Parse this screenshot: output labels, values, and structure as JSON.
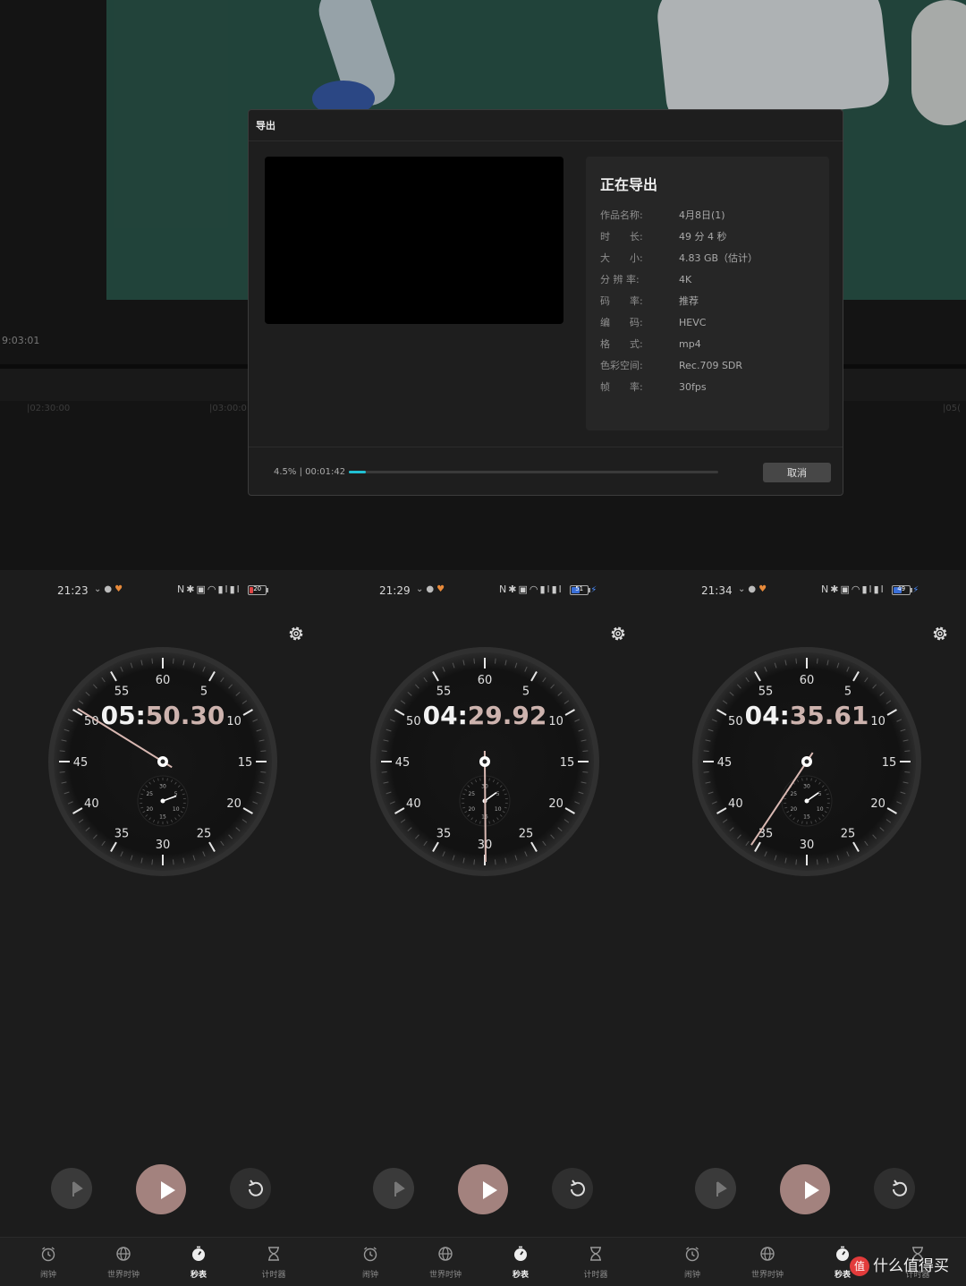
{
  "editor": {
    "timecode": "9:03:01",
    "ruler_labels": [
      "|02:30:00",
      "|03:00:0",
      "|05("
    ]
  },
  "export_dialog": {
    "title": "导出",
    "heading": "正在导出",
    "info": [
      {
        "key": "作品名称:",
        "value": "4月8日(1)"
      },
      {
        "key": "时　　长:",
        "value": "49 分 4 秒"
      },
      {
        "key": "大　　小:",
        "value": "4.83 GB（估计）"
      },
      {
        "key": "分 辨 率:",
        "value": "4K"
      },
      {
        "key": "码　　率:",
        "value": "推荐"
      },
      {
        "key": "编　　码:",
        "value": "HEVC"
      },
      {
        "key": "格　　式:",
        "value": "mp4"
      },
      {
        "key": "色彩空间:",
        "value": "Rec.709 SDR"
      },
      {
        "key": "帧　　率:",
        "value": "30fps"
      }
    ],
    "progress_percent": "4.5%",
    "progress_fraction": 0.045,
    "elapsed": "00:01:42",
    "cancel_label": "取消",
    "accent_color": "#21c0d3"
  },
  "phones": [
    {
      "status_time": "21:23",
      "battery": "20",
      "battery_color": "#e04545",
      "charging": false,
      "time_minutes": "05",
      "time_rest": "50.30",
      "seconds": 50.3,
      "small_hand_minutes": 5.83
    },
    {
      "status_time": "21:29",
      "battery": "51",
      "battery_color": "#3a6fd8",
      "charging": true,
      "time_minutes": "04",
      "time_rest": "29.92",
      "seconds": 29.92,
      "small_hand_minutes": 4.5
    },
    {
      "status_time": "21:34",
      "battery": "49",
      "battery_color": "#3a6fd8",
      "charging": true,
      "time_minutes": "04",
      "time_rest": "35.61",
      "seconds": 35.61,
      "small_hand_minutes": 4.59
    }
  ],
  "dial": {
    "major_labels": [
      "60",
      "5",
      "10",
      "15",
      "20",
      "25",
      "30",
      "35",
      "40",
      "45",
      "50",
      "55"
    ],
    "minor_labels": [
      "30",
      "5",
      "10",
      "15",
      "20",
      "25"
    ],
    "hand_color": "#d9b8b2"
  },
  "nav": [
    {
      "label": "闹钟",
      "icon": "alarm-icon"
    },
    {
      "label": "世界时钟",
      "icon": "globe-icon"
    },
    {
      "label": "秒表",
      "icon": "stopwatch-icon",
      "active": true
    },
    {
      "label": "计时器",
      "icon": "hourglass-icon"
    }
  ],
  "watermark": {
    "badge": "值",
    "text": "什么值得买"
  }
}
